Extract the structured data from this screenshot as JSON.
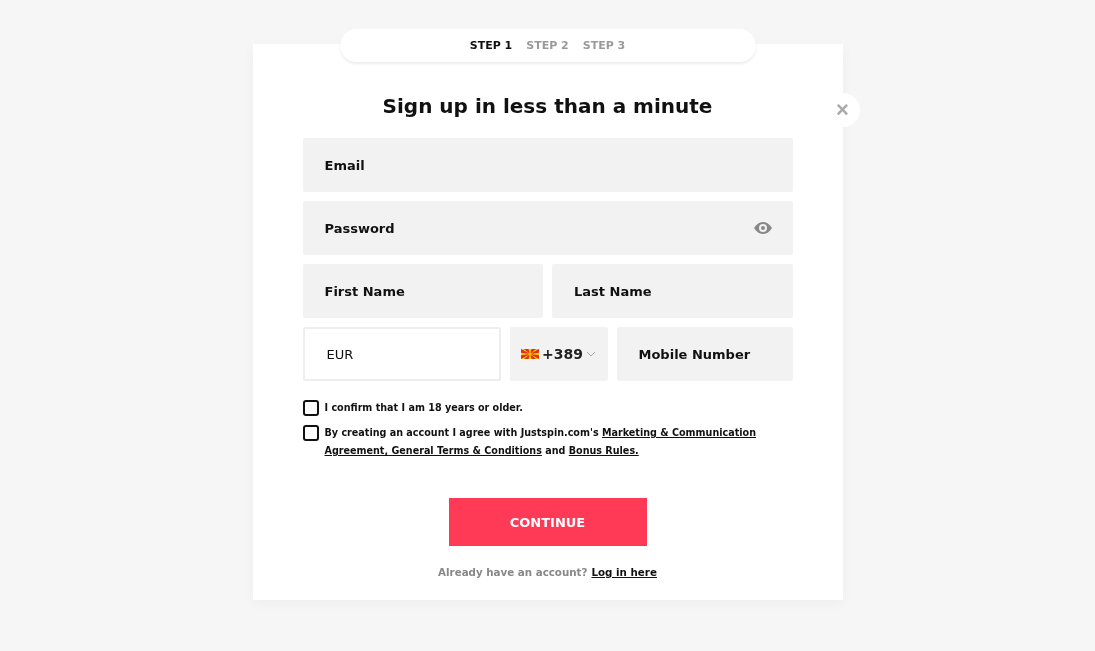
{
  "steps": [
    {
      "label": "STEP 1",
      "selected": true
    },
    {
      "label": "STEP 2",
      "selected": false
    },
    {
      "label": "STEP 3",
      "selected": false
    }
  ],
  "close": "×",
  "title": "Sign up in less than a minute",
  "email": {
    "placeholder": "Email"
  },
  "password": {
    "placeholder": "Password"
  },
  "first_name": {
    "placeholder": "First Name"
  },
  "last_name": {
    "placeholder": "Last Name"
  },
  "currency": {
    "value": "EUR"
  },
  "phone_code": {
    "value": "+389"
  },
  "mobile": {
    "placeholder": "Mobile Number"
  },
  "checkboxes": [
    {
      "checked": false,
      "segments": [
        {
          "kind": "text",
          "text": "I confirm that I am 18 years or older."
        }
      ]
    },
    {
      "checked": false,
      "segments": [
        {
          "kind": "text",
          "text": "By creating an account I agree with Justspin.com's "
        },
        {
          "kind": "link",
          "text": "Marketing & Communication"
        },
        {
          "kind": "link",
          "text": "Agreement, General Terms & Conditions"
        },
        {
          "kind": "text",
          "text": " and "
        },
        {
          "kind": "link",
          "text": "Bonus Rules."
        }
      ]
    }
  ],
  "button": "CONTINUE",
  "login": {
    "text": "Already have an account?",
    "link": "Log in here"
  }
}
